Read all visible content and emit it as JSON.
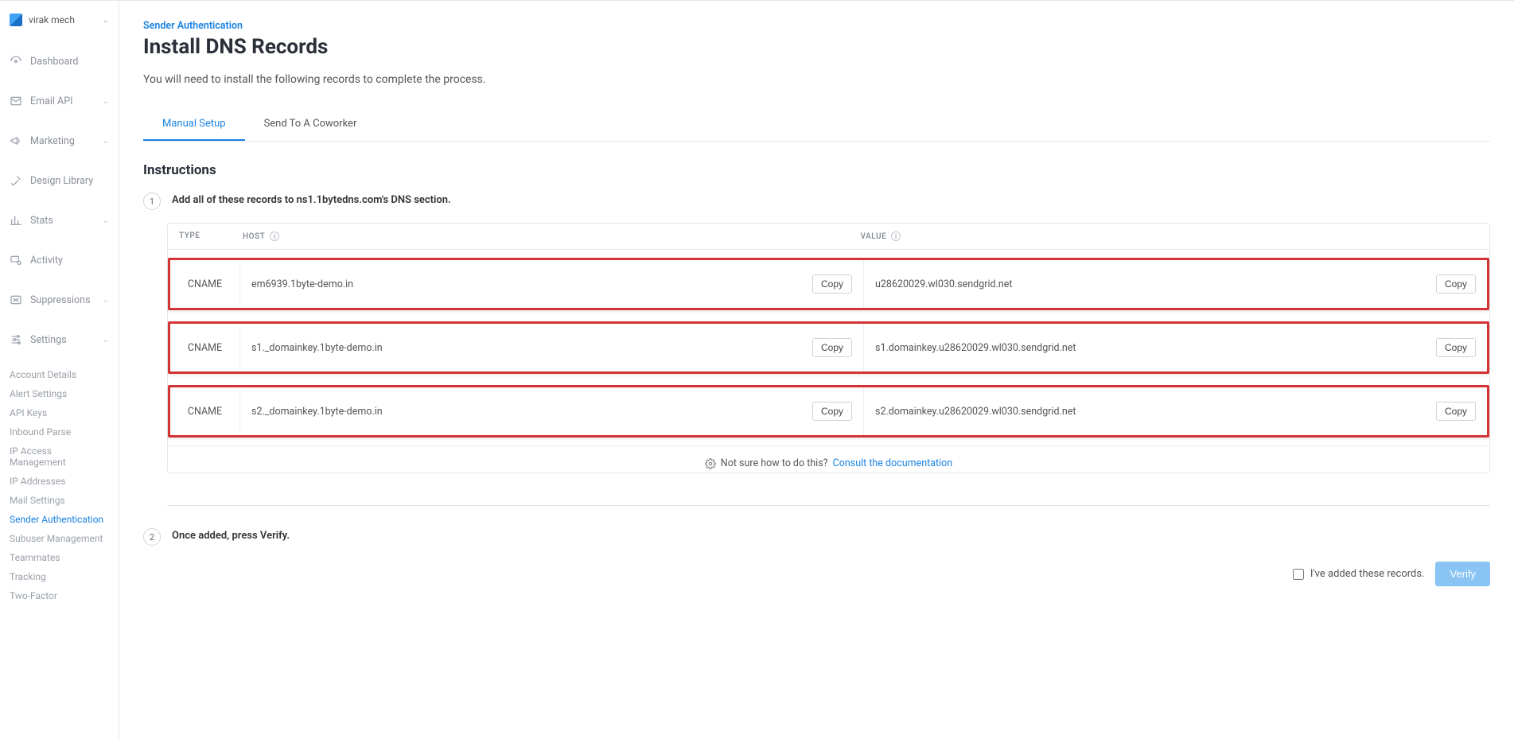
{
  "account": {
    "name": "virak mech"
  },
  "nav": {
    "items": [
      {
        "label": "Dashboard",
        "expandable": false
      },
      {
        "label": "Email API",
        "expandable": true
      },
      {
        "label": "Marketing",
        "expandable": true
      },
      {
        "label": "Design Library",
        "expandable": false
      },
      {
        "label": "Stats",
        "expandable": true
      },
      {
        "label": "Activity",
        "expandable": false
      },
      {
        "label": "Suppressions",
        "expandable": true
      },
      {
        "label": "Settings",
        "expandable": true
      }
    ],
    "settings_sub": [
      "Account Details",
      "Alert Settings",
      "API Keys",
      "Inbound Parse",
      "IP Access Management",
      "IP Addresses",
      "Mail Settings",
      "Sender Authentication",
      "Subuser Management",
      "Teammates",
      "Tracking",
      "Two-Factor"
    ],
    "active_sub": "Sender Authentication"
  },
  "page": {
    "breadcrumb": "Sender Authentication",
    "title": "Install DNS Records",
    "lead": "You will need to install the following records to complete the process.",
    "tabs": [
      {
        "label": "Manual Setup",
        "active": true
      },
      {
        "label": "Send To A Coworker",
        "active": false
      }
    ],
    "instructions_heading": "Instructions",
    "step1": "Add all of these records to ns1.1bytedns.com's DNS section.",
    "step2": "Once added, press Verify.",
    "table": {
      "headers": {
        "type": "TYPE",
        "host": "HOST",
        "value": "VALUE"
      },
      "rows": [
        {
          "type": "CNAME",
          "host": "em6939.1byte-demo.in",
          "value": "u28620029.wl030.sendgrid.net"
        },
        {
          "type": "CNAME",
          "host": "s1._domainkey.1byte-demo.in",
          "value": "s1.domainkey.u28620029.wl030.sendgrid.net"
        },
        {
          "type": "CNAME",
          "host": "s2._domainkey.1byte-demo.in",
          "value": "s2.domainkey.u28620029.wl030.sendgrid.net"
        }
      ],
      "copy_label": "Copy",
      "help_text": "Not sure how to do this?",
      "help_link": "Consult the documentation"
    },
    "verify": {
      "checkbox_label": "I've added these records.",
      "button": "Verify"
    }
  }
}
